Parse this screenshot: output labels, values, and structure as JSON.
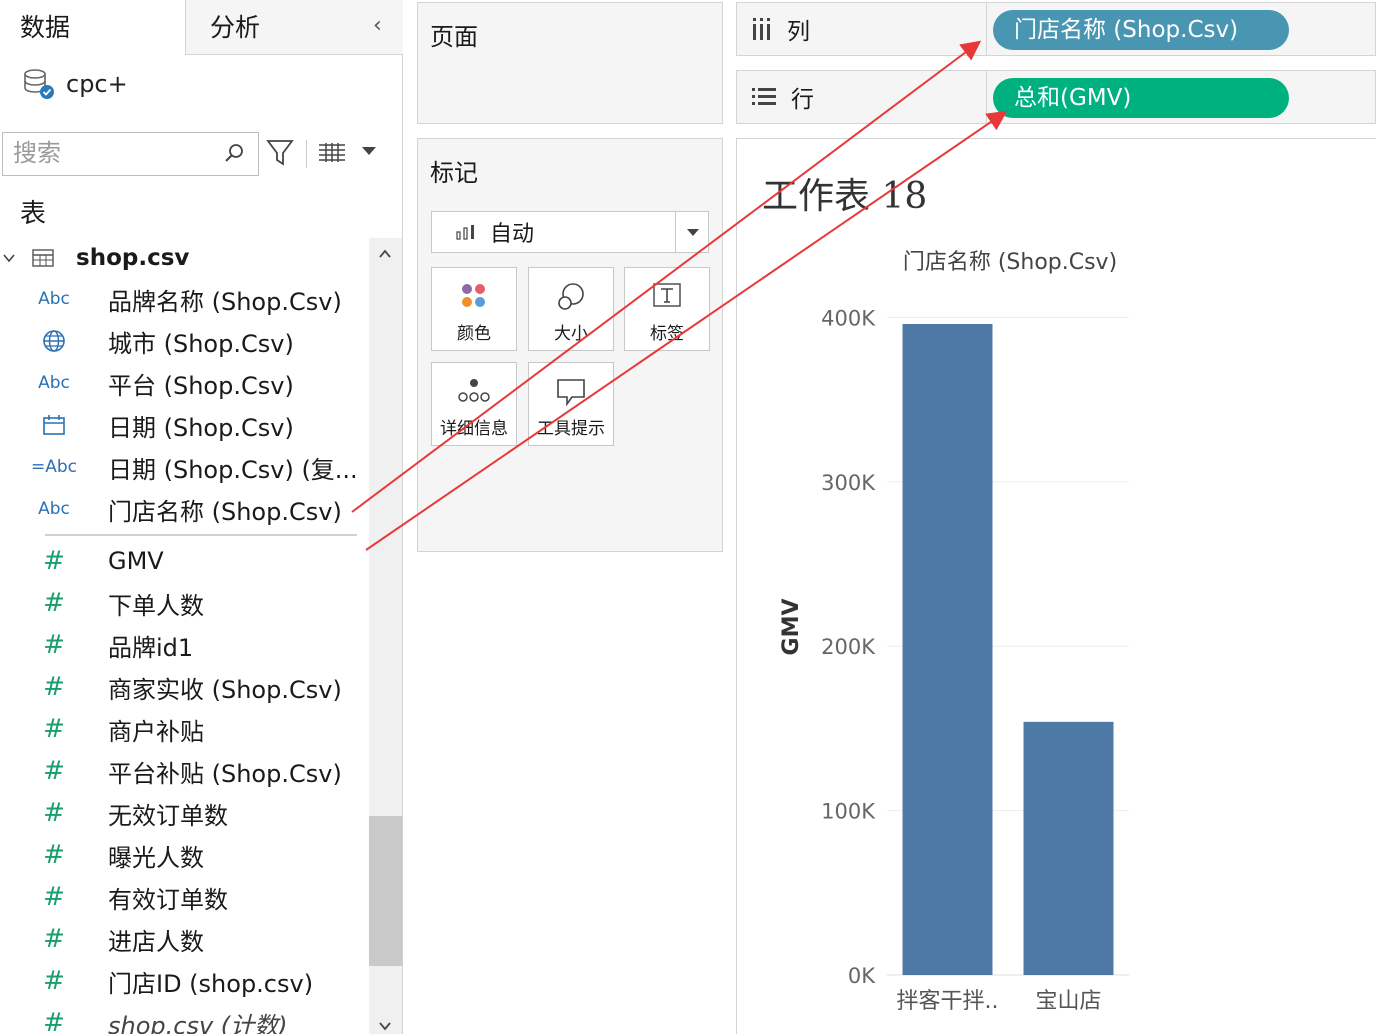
{
  "left_pane": {
    "tabs": [
      {
        "label": "数据"
      },
      {
        "label": "分析"
      }
    ],
    "datasource": "cpc+",
    "search_placeholder": "搜索",
    "section_title": "表",
    "table_name": "shop.csv",
    "fields": [
      {
        "type": "Abc",
        "name": "品牌名称 (Shop.Csv)"
      },
      {
        "type": "globe",
        "name": "城市 (Shop.Csv)"
      },
      {
        "type": "Abc",
        "name": "平台 (Shop.Csv)"
      },
      {
        "type": "calendar",
        "name": "日期 (Shop.Csv)"
      },
      {
        "type": "=Abc",
        "name": "日期 (Shop.Csv) (复..."
      },
      {
        "type": "Abc",
        "name": "门店名称 (Shop.Csv)"
      },
      {
        "type": "#",
        "name": "GMV"
      },
      {
        "type": "#",
        "name": "下单人数"
      },
      {
        "type": "#",
        "name": "品牌id1"
      },
      {
        "type": "#",
        "name": "商家实收 (Shop.Csv)"
      },
      {
        "type": "#",
        "name": "商户补贴"
      },
      {
        "type": "#",
        "name": "平台补贴 (Shop.Csv)"
      },
      {
        "type": "#",
        "name": "无效订单数"
      },
      {
        "type": "#",
        "name": "曝光人数"
      },
      {
        "type": "#",
        "name": "有效订单数"
      },
      {
        "type": "#",
        "name": "进店人数"
      },
      {
        "type": "#",
        "name": "门店ID (shop.csv)"
      },
      {
        "type": "#",
        "name": "shop.csv (计数)"
      }
    ]
  },
  "pages_card": {
    "title": "页面"
  },
  "marks_card": {
    "title": "标记",
    "mark_type": "自动",
    "buttons": {
      "color": "颜色",
      "size": "大小",
      "label": "标签",
      "detail": "详细信息",
      "tooltip": "工具提示"
    }
  },
  "shelves": {
    "columns": {
      "label": "列",
      "pill": "门店名称 (Shop.Csv)"
    },
    "rows": {
      "label": "行",
      "pill": "总和(GMV)"
    }
  },
  "view": {
    "sheet_title": "工作表 18"
  },
  "colors": {
    "bar": "#4e79a7",
    "dimension_pill": "#4996b2",
    "measure_pill": "#00b180",
    "arrow": "#e8393a"
  },
  "chart_data": {
    "type": "bar",
    "title": "工作表 18",
    "column_header": "门店名称 (Shop.Csv)",
    "xlabel": "",
    "ylabel": "GMV",
    "categories": [
      "拌客干拌..",
      "宝山店"
    ],
    "values": [
      396000,
      154000
    ],
    "ylim": [
      0,
      410000
    ],
    "yticks": [
      0,
      100000,
      200000,
      300000,
      400000
    ],
    "ytick_labels": [
      "0K",
      "100K",
      "200K",
      "300K",
      "400K"
    ],
    "grid": true
  }
}
